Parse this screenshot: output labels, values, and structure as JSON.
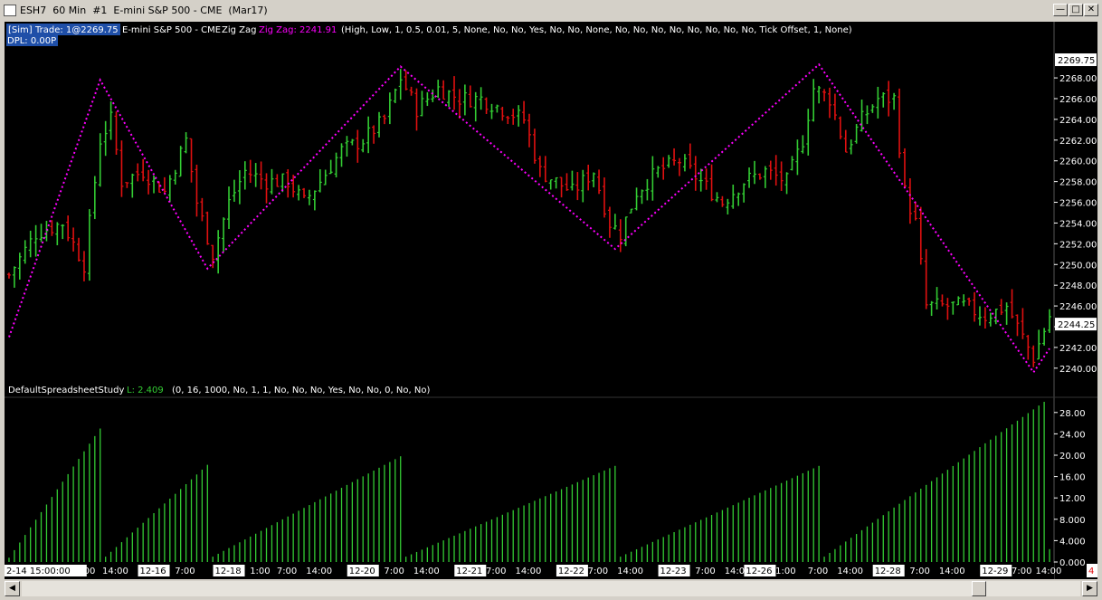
{
  "window": {
    "title": "ESH7  60 Min  #1  E-mini S&P 500 - CME  (Mar17)",
    "minimize_icon": "minimize-icon",
    "maximize_icon": "maximize-icon",
    "close_icon": "close-icon"
  },
  "header": {
    "sim_badge": "[Sim]",
    "trade_text": "Trade: 1@2269.75",
    "symbol_text": "E-mini S&P 500 - CME",
    "study_name": "Zig Zag",
    "zz_value": "Zig Zag: 2241.91",
    "zz_params": "(High, Low, 1, 0.5, 0.01, 5, None, No, No, Yes, No, No, None, No, No, No, No, No, No, No, No, Tick Offset, 1, None)",
    "dpl_text": "DPL: 0.00P"
  },
  "colors": {
    "background": "#000000",
    "up_bar": "#33cc33",
    "down_bar": "#e01010",
    "zigzag": "#ff00ff",
    "histogram": "#33cc33",
    "text": "#ffffff"
  },
  "chart_data": [
    {
      "type": "candlestick",
      "title": "ESH7 60 Min",
      "ylim": [
        2238.5,
        2270.8
      ],
      "yticks": [
        2240,
        2242,
        2244,
        2246,
        2248,
        2250,
        2252,
        2254,
        2256,
        2258,
        2260,
        2262,
        2264,
        2266,
        2268
      ],
      "last_price_label": "2244.25",
      "high_price_label": "2269.75",
      "zigzag_pivots": [
        {
          "bar": 0,
          "price": 2243.0
        },
        {
          "bar": 17,
          "price": 2267.8
        },
        {
          "bar": 37,
          "price": 2249.6
        },
        {
          "bar": 73,
          "price": 2269.1
        },
        {
          "bar": 113,
          "price": 2251.5
        },
        {
          "bar": 151,
          "price": 2269.3
        },
        {
          "bar": 191,
          "price": 2239.6
        },
        {
          "bar": 194,
          "price": 2241.9
        }
      ],
      "bar_count": 195,
      "close_points": [
        {
          "bar": 0,
          "price": 2249
        },
        {
          "bar": 5,
          "price": 2253
        },
        {
          "bar": 10,
          "price": 2254
        },
        {
          "bar": 14,
          "price": 2250
        },
        {
          "bar": 17,
          "price": 2262
        },
        {
          "bar": 19,
          "price": 2264
        },
        {
          "bar": 21,
          "price": 2258
        },
        {
          "bar": 25,
          "price": 2259
        },
        {
          "bar": 29,
          "price": 2257
        },
        {
          "bar": 33,
          "price": 2262
        },
        {
          "bar": 35,
          "price": 2256
        },
        {
          "bar": 38,
          "price": 2251
        },
        {
          "bar": 41,
          "price": 2256
        },
        {
          "bar": 44,
          "price": 2259
        },
        {
          "bar": 48,
          "price": 2258
        },
        {
          "bar": 52,
          "price": 2258
        },
        {
          "bar": 55,
          "price": 2256
        },
        {
          "bar": 58,
          "price": 2258
        },
        {
          "bar": 62,
          "price": 2261
        },
        {
          "bar": 66,
          "price": 2262
        },
        {
          "bar": 70,
          "price": 2264
        },
        {
          "bar": 73,
          "price": 2268
        },
        {
          "bar": 76,
          "price": 2265
        },
        {
          "bar": 80,
          "price": 2267
        },
        {
          "bar": 84,
          "price": 2266
        },
        {
          "bar": 88,
          "price": 2266
        },
        {
          "bar": 92,
          "price": 2265
        },
        {
          "bar": 96,
          "price": 2264
        },
        {
          "bar": 99,
          "price": 2259
        },
        {
          "bar": 102,
          "price": 2258
        },
        {
          "bar": 105,
          "price": 2257
        },
        {
          "bar": 109,
          "price": 2259
        },
        {
          "bar": 112,
          "price": 2254
        },
        {
          "bar": 114,
          "price": 2253
        },
        {
          "bar": 117,
          "price": 2257
        },
        {
          "bar": 121,
          "price": 2259
        },
        {
          "bar": 125,
          "price": 2260
        },
        {
          "bar": 129,
          "price": 2258
        },
        {
          "bar": 133,
          "price": 2256
        },
        {
          "bar": 137,
          "price": 2258
        },
        {
          "bar": 141,
          "price": 2259
        },
        {
          "bar": 145,
          "price": 2258
        },
        {
          "bar": 148,
          "price": 2262
        },
        {
          "bar": 150,
          "price": 2267
        },
        {
          "bar": 153,
          "price": 2266
        },
        {
          "bar": 156,
          "price": 2261
        },
        {
          "bar": 159,
          "price": 2264
        },
        {
          "bar": 162,
          "price": 2266
        },
        {
          "bar": 165,
          "price": 2266
        },
        {
          "bar": 167,
          "price": 2257
        },
        {
          "bar": 169,
          "price": 2254
        },
        {
          "bar": 171,
          "price": 2246
        },
        {
          "bar": 175,
          "price": 2246
        },
        {
          "bar": 178,
          "price": 2246
        },
        {
          "bar": 182,
          "price": 2245
        },
        {
          "bar": 186,
          "price": 2246
        },
        {
          "bar": 189,
          "price": 2243
        },
        {
          "bar": 191,
          "price": 2241
        },
        {
          "bar": 194,
          "price": 2245
        }
      ],
      "xlabels": [
        {
          "bar": 0,
          "label": "2-14  15:00:00"
        },
        {
          "bar": 15,
          "label": "00"
        },
        {
          "bar": 20,
          "label": "14:00"
        },
        {
          "bar": 27,
          "label": "12-16"
        },
        {
          "bar": 33,
          "label": "7:00"
        },
        {
          "bar": 41,
          "label": "12-18"
        },
        {
          "bar": 47,
          "label": "1:00"
        },
        {
          "bar": 52,
          "label": "7:00"
        },
        {
          "bar": 58,
          "label": "14:00"
        },
        {
          "bar": 66,
          "label": "12-20"
        },
        {
          "bar": 72,
          "label": "7:00"
        },
        {
          "bar": 78,
          "label": "14:00"
        },
        {
          "bar": 86,
          "label": "12-21"
        },
        {
          "bar": 91,
          "label": "7:00"
        },
        {
          "bar": 97,
          "label": "14:00"
        },
        {
          "bar": 105,
          "label": "12-22"
        },
        {
          "bar": 110,
          "label": "7:00"
        },
        {
          "bar": 116,
          "label": "14:00"
        },
        {
          "bar": 124,
          "label": "12-23"
        },
        {
          "bar": 130,
          "label": "7:00"
        },
        {
          "bar": 136,
          "label": "14:00"
        },
        {
          "bar": 140,
          "label": "12-26"
        },
        {
          "bar": 145,
          "label": "1:00"
        },
        {
          "bar": 151,
          "label": "7:00"
        },
        {
          "bar": 157,
          "label": "14:00"
        },
        {
          "bar": 164,
          "label": "12-28"
        },
        {
          "bar": 170,
          "label": "7:00"
        },
        {
          "bar": 176,
          "label": "14:00"
        },
        {
          "bar": 184,
          "label": "12-29"
        },
        {
          "bar": 189,
          "label": "7:00"
        },
        {
          "bar": 195,
          "label": "14:00"
        }
      ],
      "scroll_box_label": "4"
    },
    {
      "type": "bar",
      "study_name": "DefaultSpreadsheetStudy",
      "last_value": "L: 2.409",
      "params": "(0, 16, 1000, No, 1, 1, No, No, No, Yes, No, No, 0, No, No)",
      "ylim": [
        0,
        30
      ],
      "yticks": [
        "0.000",
        "4.000",
        "8.000",
        "12.00",
        "16.00",
        "20.00",
        "24.00",
        "28.00"
      ],
      "segments": [
        {
          "start_bar": 0,
          "end_bar": 17,
          "start_value": 0.8,
          "end_value": 25.0
        },
        {
          "start_bar": 18,
          "end_bar": 37,
          "start_value": 1.0,
          "end_value": 18.2
        },
        {
          "start_bar": 38,
          "end_bar": 73,
          "start_value": 1.0,
          "end_value": 19.8
        },
        {
          "start_bar": 74,
          "end_bar": 113,
          "start_value": 1.0,
          "end_value": 18.0
        },
        {
          "start_bar": 114,
          "end_bar": 151,
          "start_value": 1.0,
          "end_value": 18.0
        },
        {
          "start_bar": 152,
          "end_bar": 193,
          "start_value": 1.0,
          "end_value": 30.0
        },
        {
          "start_bar": 194,
          "end_bar": 194,
          "start_value": 2.409,
          "end_value": 2.409
        }
      ]
    }
  ]
}
